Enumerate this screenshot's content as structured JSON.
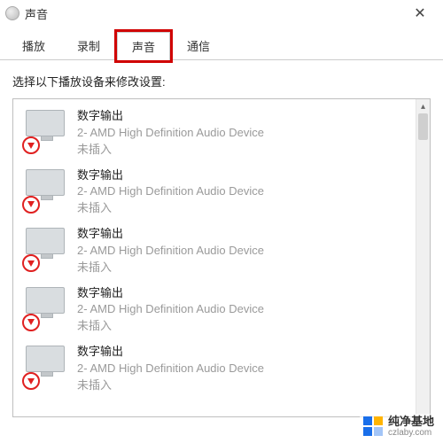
{
  "window": {
    "title": "声音",
    "close_glyph": "✕"
  },
  "tabs": [
    {
      "label": "播放",
      "active": false,
      "highlight": false
    },
    {
      "label": "录制",
      "active": false,
      "highlight": false
    },
    {
      "label": "声音",
      "active": true,
      "highlight": true
    },
    {
      "label": "通信",
      "active": false,
      "highlight": false
    }
  ],
  "instruction": "选择以下播放设备来修改设置:",
  "devices": [
    {
      "name": "数字输出",
      "desc": "2- AMD High Definition Audio Device",
      "status": "未插入"
    },
    {
      "name": "数字输出",
      "desc": "2- AMD High Definition Audio Device",
      "status": "未插入"
    },
    {
      "name": "数字输出",
      "desc": "2- AMD High Definition Audio Device",
      "status": "未插入"
    },
    {
      "name": "数字输出",
      "desc": "2- AMD High Definition Audio Device",
      "status": "未插入"
    },
    {
      "name": "数字输出",
      "desc": "2- AMD High Definition Audio Device",
      "status": "未插入"
    }
  ],
  "scrollbar": {
    "up_glyph": "▴"
  },
  "watermark": {
    "name": "纯净基地",
    "url": "czlaby.com"
  }
}
